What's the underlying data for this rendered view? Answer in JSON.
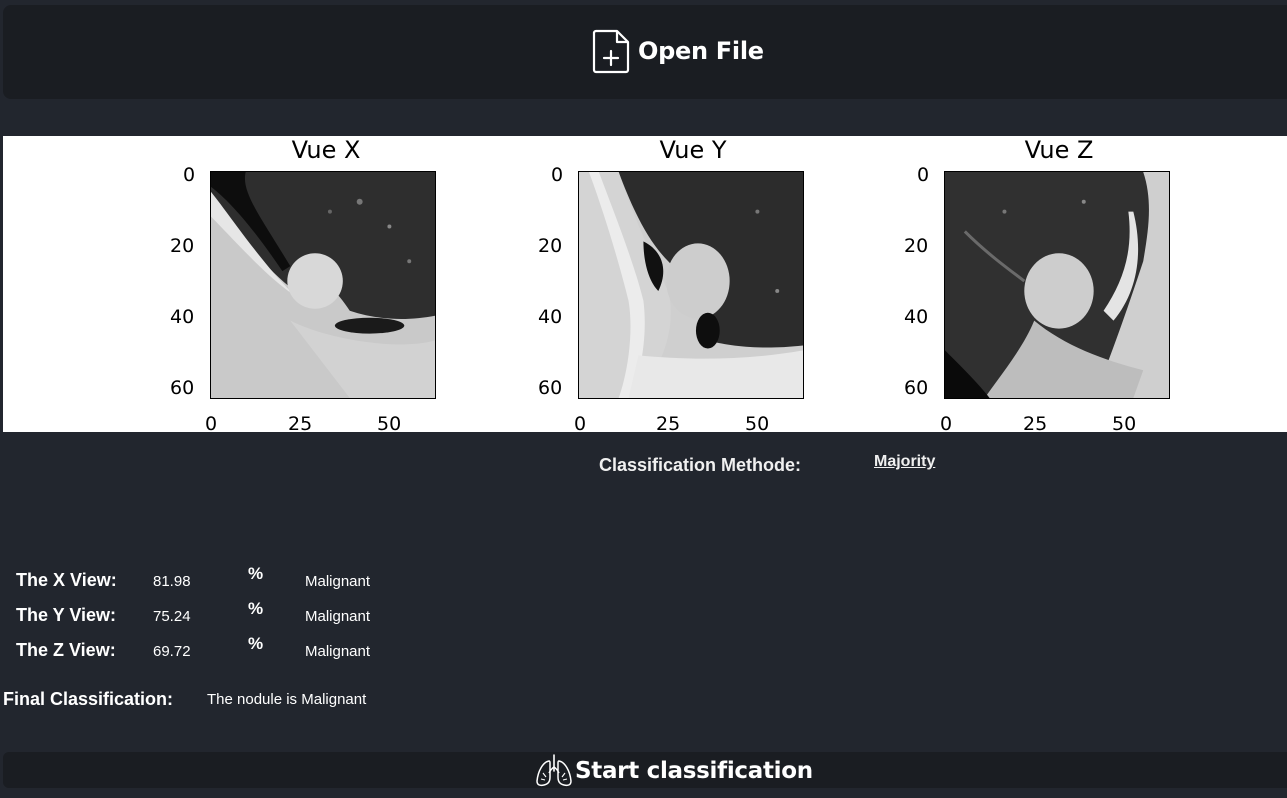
{
  "toolbar": {
    "open_label": "Open File",
    "open_icon": "file-plus-icon"
  },
  "views": [
    {
      "title": "Vue X",
      "yticks": [
        "0",
        "20",
        "40",
        "60"
      ],
      "xticks": [
        "0",
        "25",
        "50"
      ]
    },
    {
      "title": "Vue Y",
      "yticks": [
        "0",
        "20",
        "40",
        "60"
      ],
      "xticks": [
        "0",
        "25",
        "50"
      ]
    },
    {
      "title": "Vue Z",
      "yticks": [
        "0",
        "20",
        "40",
        "60"
      ],
      "xticks": [
        "0",
        "25",
        "50"
      ]
    }
  ],
  "method": {
    "label": "Classification Methode:",
    "value": "Majority"
  },
  "results": [
    {
      "label": "The X View:",
      "value": "81.98",
      "unit": "%",
      "class": "Malignant"
    },
    {
      "label": "The Y View:",
      "value": "75.24",
      "unit": "%",
      "class": "Malignant"
    },
    {
      "label": "The Z View:",
      "value": "69.72",
      "unit": "%",
      "class": "Malignant"
    }
  ],
  "final": {
    "label": "Final Classification:",
    "value": "The nodule is Malignant"
  },
  "start": {
    "label": "Start classification",
    "icon": "lungs-icon"
  }
}
